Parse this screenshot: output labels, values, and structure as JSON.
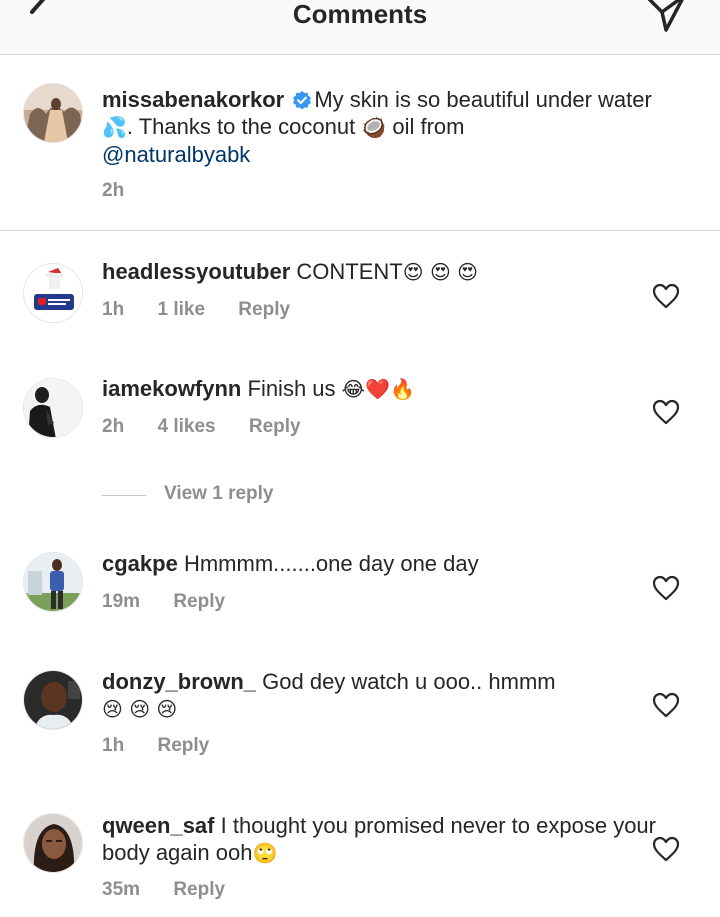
{
  "header": {
    "title": "Comments",
    "back_icon": "chevron-left-icon",
    "send_icon": "direct-send-icon"
  },
  "caption": {
    "username": "missabenakorkor",
    "verified_icon": "verified-badge-icon",
    "text_1": "My skin is so beautiful under water ",
    "emoji_1": "💦",
    "text_2": ". Thanks to the coconut ",
    "emoji_2": "🥥",
    "text_3": " oil from ",
    "mention": "@naturalbyabk",
    "time": "2h"
  },
  "comments": [
    {
      "username": "headlessyoutuber",
      "text": "CONTENT",
      "emojis": "😍 😍 😍",
      "time": "1h",
      "likes": "1 like",
      "reply": "Reply"
    },
    {
      "username": "iamekowfynn",
      "text": "Finish us",
      "emojis": "😂❤️🔥",
      "time": "2h",
      "likes": "4 likes",
      "reply": "Reply",
      "view_replies": "View 1 reply"
    },
    {
      "username": "cgakpe",
      "text": "Hmmmm.......one day one day",
      "time": "19m",
      "reply": "Reply"
    },
    {
      "username": "donzy_brown_",
      "text": "God dey watch u ooo.. hmmm",
      "emojis": "😢 😢 😢",
      "time": "1h",
      "reply": "Reply"
    },
    {
      "username": "qween_saf",
      "text": "I thought you promised never to expose your body again ooh",
      "emojis": "🙄",
      "time": "35m",
      "reply": "Reply"
    }
  ],
  "colors": {
    "text": "#262626",
    "secondary": "#8e8e8e",
    "link": "#00376b",
    "verified": "#3897f0",
    "divider": "#dbdbdb"
  }
}
